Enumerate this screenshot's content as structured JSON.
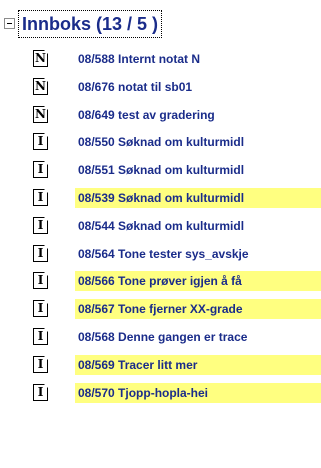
{
  "folder": {
    "label": "Innboks (13 / 5 )"
  },
  "colors": {
    "highlight": "#ffff80",
    "text": "#1a2c8a"
  },
  "items": [
    {
      "icon": "N",
      "icon_name": "note-n-icon",
      "label": "08/588 Internt notat N",
      "highlight": false
    },
    {
      "icon": "N",
      "icon_name": "note-n-icon",
      "label": "08/676 notat til sb01",
      "highlight": false
    },
    {
      "icon": "N",
      "icon_name": "note-n-icon",
      "label": "08/649 test av gradering",
      "highlight": false
    },
    {
      "icon": "I",
      "icon_name": "incoming-i-icon",
      "label": "08/550 Søknad om kulturmidl",
      "highlight": false
    },
    {
      "icon": "I",
      "icon_name": "incoming-i-icon",
      "label": "08/551 Søknad om kulturmidl",
      "highlight": false
    },
    {
      "icon": "I",
      "icon_name": "incoming-i-icon",
      "label": "08/539 Søknad om kulturmidl",
      "highlight": true
    },
    {
      "icon": "I",
      "icon_name": "incoming-i-icon",
      "label": "08/544 Søknad om kulturmidl",
      "highlight": false
    },
    {
      "icon": "I",
      "icon_name": "incoming-i-icon",
      "label": "08/564 Tone tester sys_avskje",
      "highlight": false
    },
    {
      "icon": "I",
      "icon_name": "incoming-i-icon",
      "label": "08/566 Tone prøver igjen å få",
      "highlight": true
    },
    {
      "icon": "I",
      "icon_name": "incoming-i-icon",
      "label": "08/567 Tone fjerner XX-grade",
      "highlight": true
    },
    {
      "icon": "I",
      "icon_name": "incoming-i-icon",
      "label": "08/568 Denne gangen er trace",
      "highlight": false
    },
    {
      "icon": "I",
      "icon_name": "incoming-i-icon",
      "label": "08/569 Tracer litt mer",
      "highlight": true
    },
    {
      "icon": "I",
      "icon_name": "incoming-i-icon",
      "label": "08/570 Tjopp-hopla-hei",
      "highlight": true
    }
  ]
}
